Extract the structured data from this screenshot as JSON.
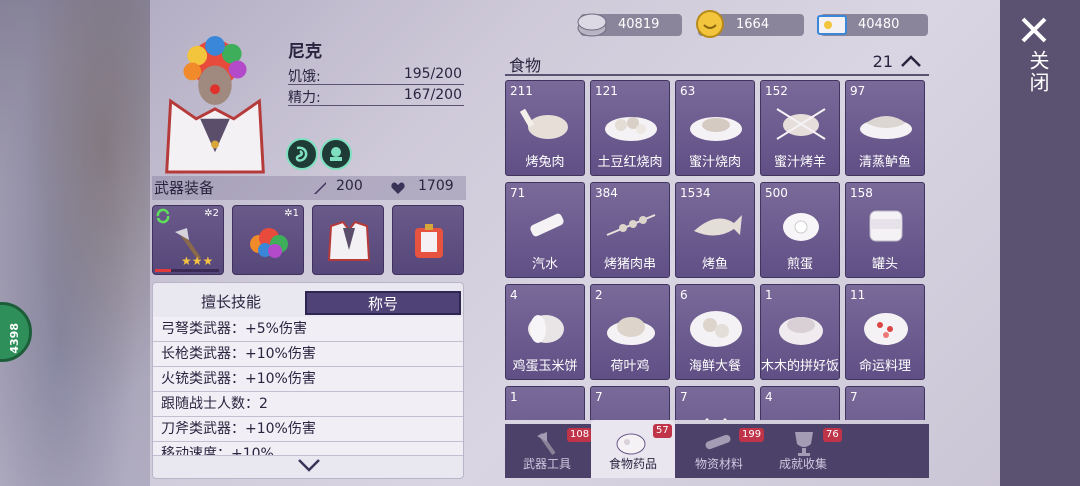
{
  "character": {
    "name": "尼克",
    "hunger_label": "饥饿:",
    "hunger_value": "195/200",
    "energy_label": "精力:",
    "energy_value": "167/200"
  },
  "equipment": {
    "title": "武器装备",
    "attack": "200",
    "health": "1709",
    "slots": [
      {
        "level": "2",
        "stars": 3
      },
      {
        "level": "1"
      },
      {},
      {}
    ]
  },
  "skills": {
    "tabs": [
      "擅长技能",
      "称号"
    ],
    "active_tab": 1,
    "rows": [
      "弓弩类武器：+5%伤害",
      "长枪类武器：+10%伤害",
      "火铳类武器：+10%伤害",
      "跟随战士人数：2",
      "刀斧类武器：+10%伤害",
      "移动速度：+10%"
    ]
  },
  "currency": [
    {
      "icon": "silver-coin-icon",
      "value": "40819"
    },
    {
      "icon": "gold-coin-icon",
      "value": "1664"
    },
    {
      "icon": "ticket-icon",
      "value": "40480"
    }
  ],
  "category": {
    "title": "食物",
    "count": "21"
  },
  "items": [
    {
      "qty": "211",
      "name": "烤兔肉",
      "icon": "roast-rabbit-icon"
    },
    {
      "qty": "121",
      "name": "土豆红烧肉",
      "icon": "potato-braised-pork-icon"
    },
    {
      "qty": "63",
      "name": "蜜汁烧肉",
      "icon": "honey-pork-icon"
    },
    {
      "qty": "152",
      "name": "蜜汁烤羊",
      "icon": "honey-lamb-icon"
    },
    {
      "qty": "97",
      "name": "清蒸鲈鱼",
      "icon": "steamed-fish-icon"
    },
    {
      "qty": "71",
      "name": "汽水",
      "icon": "soda-icon"
    },
    {
      "qty": "384",
      "name": "烤猪肉串",
      "icon": "pork-skewer-icon"
    },
    {
      "qty": "1534",
      "name": "烤鱼",
      "icon": "grilled-fish-icon"
    },
    {
      "qty": "500",
      "name": "煎蛋",
      "icon": "fried-egg-icon"
    },
    {
      "qty": "158",
      "name": "罐头",
      "icon": "can-icon"
    },
    {
      "qty": "4",
      "name": "鸡蛋玉米饼",
      "icon": "egg-cornbread-icon"
    },
    {
      "qty": "2",
      "name": "荷叶鸡",
      "icon": "lotus-chicken-icon"
    },
    {
      "qty": "6",
      "name": "海鲜大餐",
      "icon": "seafood-feast-icon"
    },
    {
      "qty": "1",
      "name": "木木的拼好饭",
      "icon": "mumu-meal-icon"
    },
    {
      "qty": "11",
      "name": "命运料理",
      "icon": "fate-dish-icon"
    },
    {
      "qty": "1",
      "name": "",
      "icon": "food-icon"
    },
    {
      "qty": "7",
      "name": "",
      "icon": "food-icon"
    },
    {
      "qty": "7",
      "name": "",
      "icon": "food-icon"
    },
    {
      "qty": "4",
      "name": "",
      "icon": "food-icon"
    },
    {
      "qty": "7",
      "name": "",
      "icon": "food-icon"
    }
  ],
  "tabs": [
    {
      "label": "武器工具",
      "count": "108"
    },
    {
      "label": "食物药品",
      "count": "57"
    },
    {
      "label": "物资材料",
      "count": "199"
    },
    {
      "label": "成就收集",
      "count": "76"
    }
  ],
  "active_bottom_tab": 1,
  "close_label": "关闭",
  "side_badge": "4398",
  "colors": {
    "panel_purple": "#604f85",
    "accent_red": "#c0344a",
    "bar_dark": "#4c4168"
  }
}
